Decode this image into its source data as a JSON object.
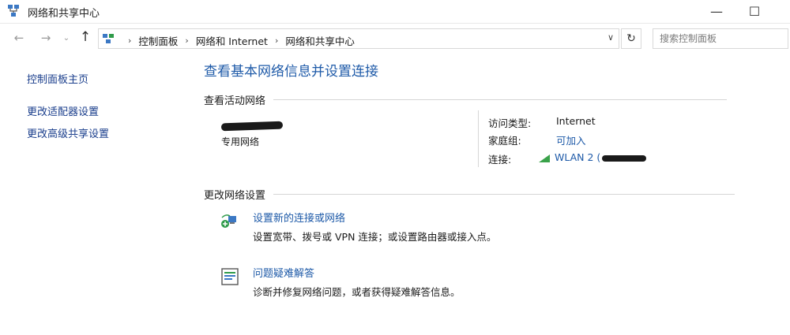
{
  "window": {
    "title": "网络和共享中心",
    "minimize_symbol": "—",
    "maximize_symbol": "☐"
  },
  "address_bar": {
    "nav": {
      "back": "←",
      "forward": "→",
      "history": "⌄",
      "up": "↑"
    },
    "breadcrumbs": [
      "控制面板",
      "网络和 Internet",
      "网络和共享中心"
    ],
    "separator": "›",
    "dropdown_symbol": "∨",
    "refresh_symbol": "↻",
    "search_placeholder": "搜索控制面板"
  },
  "sidebar": {
    "items": [
      {
        "label": "控制面板主页"
      },
      {
        "label": "更改适配器设置"
      },
      {
        "label": "更改高级共享设置"
      }
    ]
  },
  "main": {
    "title": "查看基本网络信息并设置连接",
    "active_networks": {
      "heading": "查看活动网络",
      "network_category": "专用网络",
      "access_type_label": "访问类型:",
      "access_type_value": "Internet",
      "homegroup_label": "家庭组:",
      "homegroup_value": "可加入",
      "connections_label": "连接:",
      "connection_value": "WLAN 2 ("
    },
    "change_settings": {
      "heading": "更改网络设置",
      "tasks": [
        {
          "link": "设置新的连接或网络",
          "description": "设置宽带、拨号或 VPN 连接；或设置路由器或接入点。"
        },
        {
          "link": "问题疑难解答",
          "description": "诊断并修复网络问题，或者获得疑难解答信息。"
        }
      ]
    }
  },
  "colors": {
    "link": "#1e5aa8",
    "signal": "#3aa24a"
  }
}
